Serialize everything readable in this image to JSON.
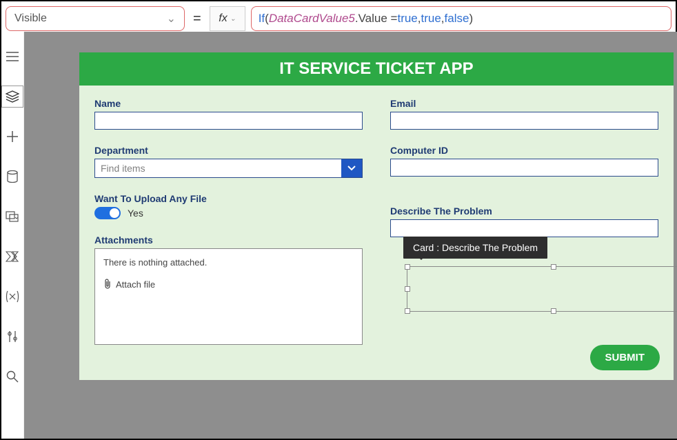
{
  "formula_bar": {
    "property": "Visible",
    "equals": "=",
    "fx_label": "fx",
    "expr_tokens": {
      "fn": "If",
      "open": "(",
      "italic": "DataCardValue5",
      "rest1": ".Value = ",
      "true1": "true",
      "comma1": ", ",
      "true2": "true",
      "comma2": ", ",
      "false1": "false",
      "close": ")"
    }
  },
  "left_rail": {
    "hamburger": "hamburger-icon",
    "layers": "layers-icon",
    "insert": "plus-icon",
    "data": "database-icon",
    "media": "media-icon",
    "power": "automate-icon",
    "var": "variable-icon",
    "tools": "tools-icon",
    "search": "search-icon"
  },
  "app": {
    "title": "IT SERVICE TICKET APP",
    "name_label": "Name",
    "email_label": "Email",
    "dept_label": "Department",
    "dept_placeholder": "Find items",
    "comp_label": "Computer ID",
    "upload_label": "Want To Upload Any File",
    "toggle_value": "Yes",
    "attach_label": "Attachments",
    "attach_empty": "There is nothing attached.",
    "attach_action": "Attach file",
    "describe_label": "Describe The Problem",
    "submit": "SUBMIT"
  },
  "tooltip": "Card : Describe The Problem"
}
